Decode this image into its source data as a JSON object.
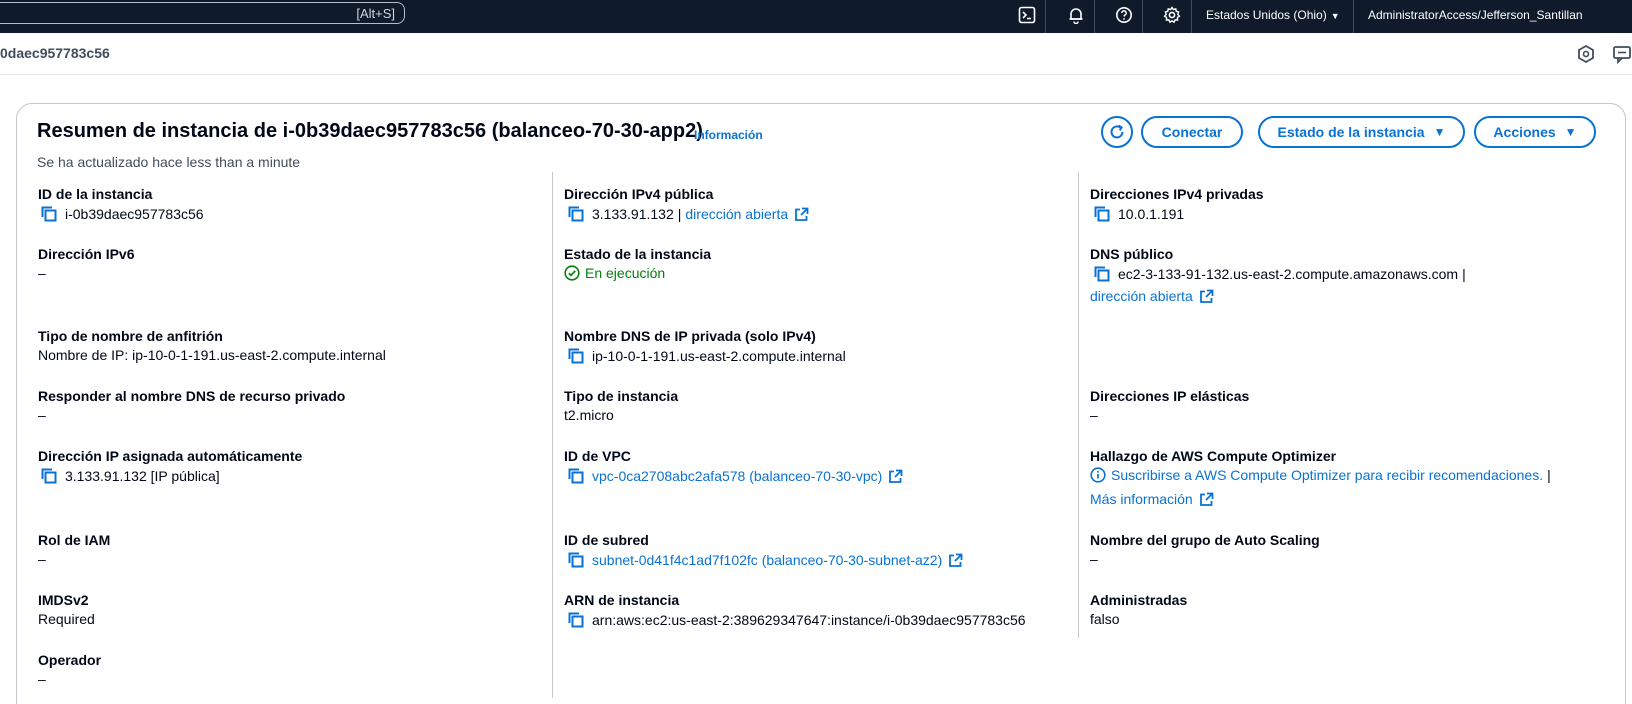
{
  "topbar": {
    "search_shortcut": "[Alt+S]",
    "region": "Estados Unidos (Ohio)",
    "account": "AdministratorAccess/Jefferson_Santillan"
  },
  "breadcrumb": {
    "instance": "0daec957783c56"
  },
  "panel": {
    "title": "Resumen de instancia de i-0b39daec957783c56 (balanceo-70-30-app2)",
    "info_link": "Información",
    "updated": "Se ha actualizado hace less than a minute",
    "buttons": {
      "connect": "Conectar",
      "instance_state": "Estado de la instancia",
      "actions": "Acciones"
    }
  },
  "col1": {
    "instance_id_label": "ID de la instancia",
    "instance_id": "i-0b39daec957783c56",
    "ipv6_label": "Dirección IPv6",
    "ipv6": "–",
    "hostname_type_label": "Tipo de nombre de anfitrión",
    "hostname_type": "Nombre de IP: ip-10-0-1-191.us-east-2.compute.internal",
    "private_dns_answer_label": "Responder al nombre DNS de recurso privado",
    "private_dns_answer": "–",
    "auto_ip_label": "Dirección IP asignada automáticamente",
    "auto_ip": "3.133.91.132 [IP pública]",
    "iam_label": "Rol de IAM",
    "iam": "–",
    "imds_label": "IMDSv2",
    "imds": "Required",
    "operator_label": "Operador",
    "operator": "–"
  },
  "col2": {
    "public_ipv4_label": "Dirección IPv4 pública",
    "public_ipv4": "3.133.91.132",
    "open_address": "dirección abierta",
    "state_label": "Estado de la instancia",
    "state": "En ejecución",
    "private_dns_label": "Nombre DNS de IP privada (solo IPv4)",
    "private_dns": "ip-10-0-1-191.us-east-2.compute.internal",
    "type_label": "Tipo de instancia",
    "type": "t2.micro",
    "vpc_label": "ID de VPC",
    "vpc": "vpc-0ca2708abc2afa578 (balanceo-70-30-vpc)",
    "subnet_label": "ID de subred",
    "subnet": "subnet-0d41f4c1ad7f102fc (balanceo-70-30-subnet-az2)",
    "arn_label": "ARN de instancia",
    "arn": "arn:aws:ec2:us-east-2:389629347647:instance/i-0b39daec957783c56"
  },
  "col3": {
    "private_ipv4_label": "Direcciones IPv4 privadas",
    "private_ipv4": "10.0.1.191",
    "public_dns_label": "DNS público",
    "public_dns": "ec2-3-133-91-132.us-east-2.compute.amazonaws.com",
    "open_address": "dirección abierta",
    "elastic_label": "Direcciones IP elásticas",
    "elastic": "–",
    "optimizer_label": "Hallazgo de AWS Compute Optimizer",
    "optimizer_link": "Suscribirse a AWS Compute Optimizer para recibir recomendaciones.",
    "more_info": "Más información",
    "asg_label": "Nombre del grupo de Auto Scaling",
    "asg": "–",
    "managed_label": "Administradas",
    "managed": "falso"
  },
  "icons": {
    "copy": "copy-icon",
    "external": "external-link-icon",
    "refresh": "refresh-icon",
    "status": "check-circle-icon",
    "info": "info-circle-icon"
  },
  "colors": {
    "link": "#0972d3",
    "success": "#037f0c",
    "nav_bg": "#0f1b2a"
  }
}
